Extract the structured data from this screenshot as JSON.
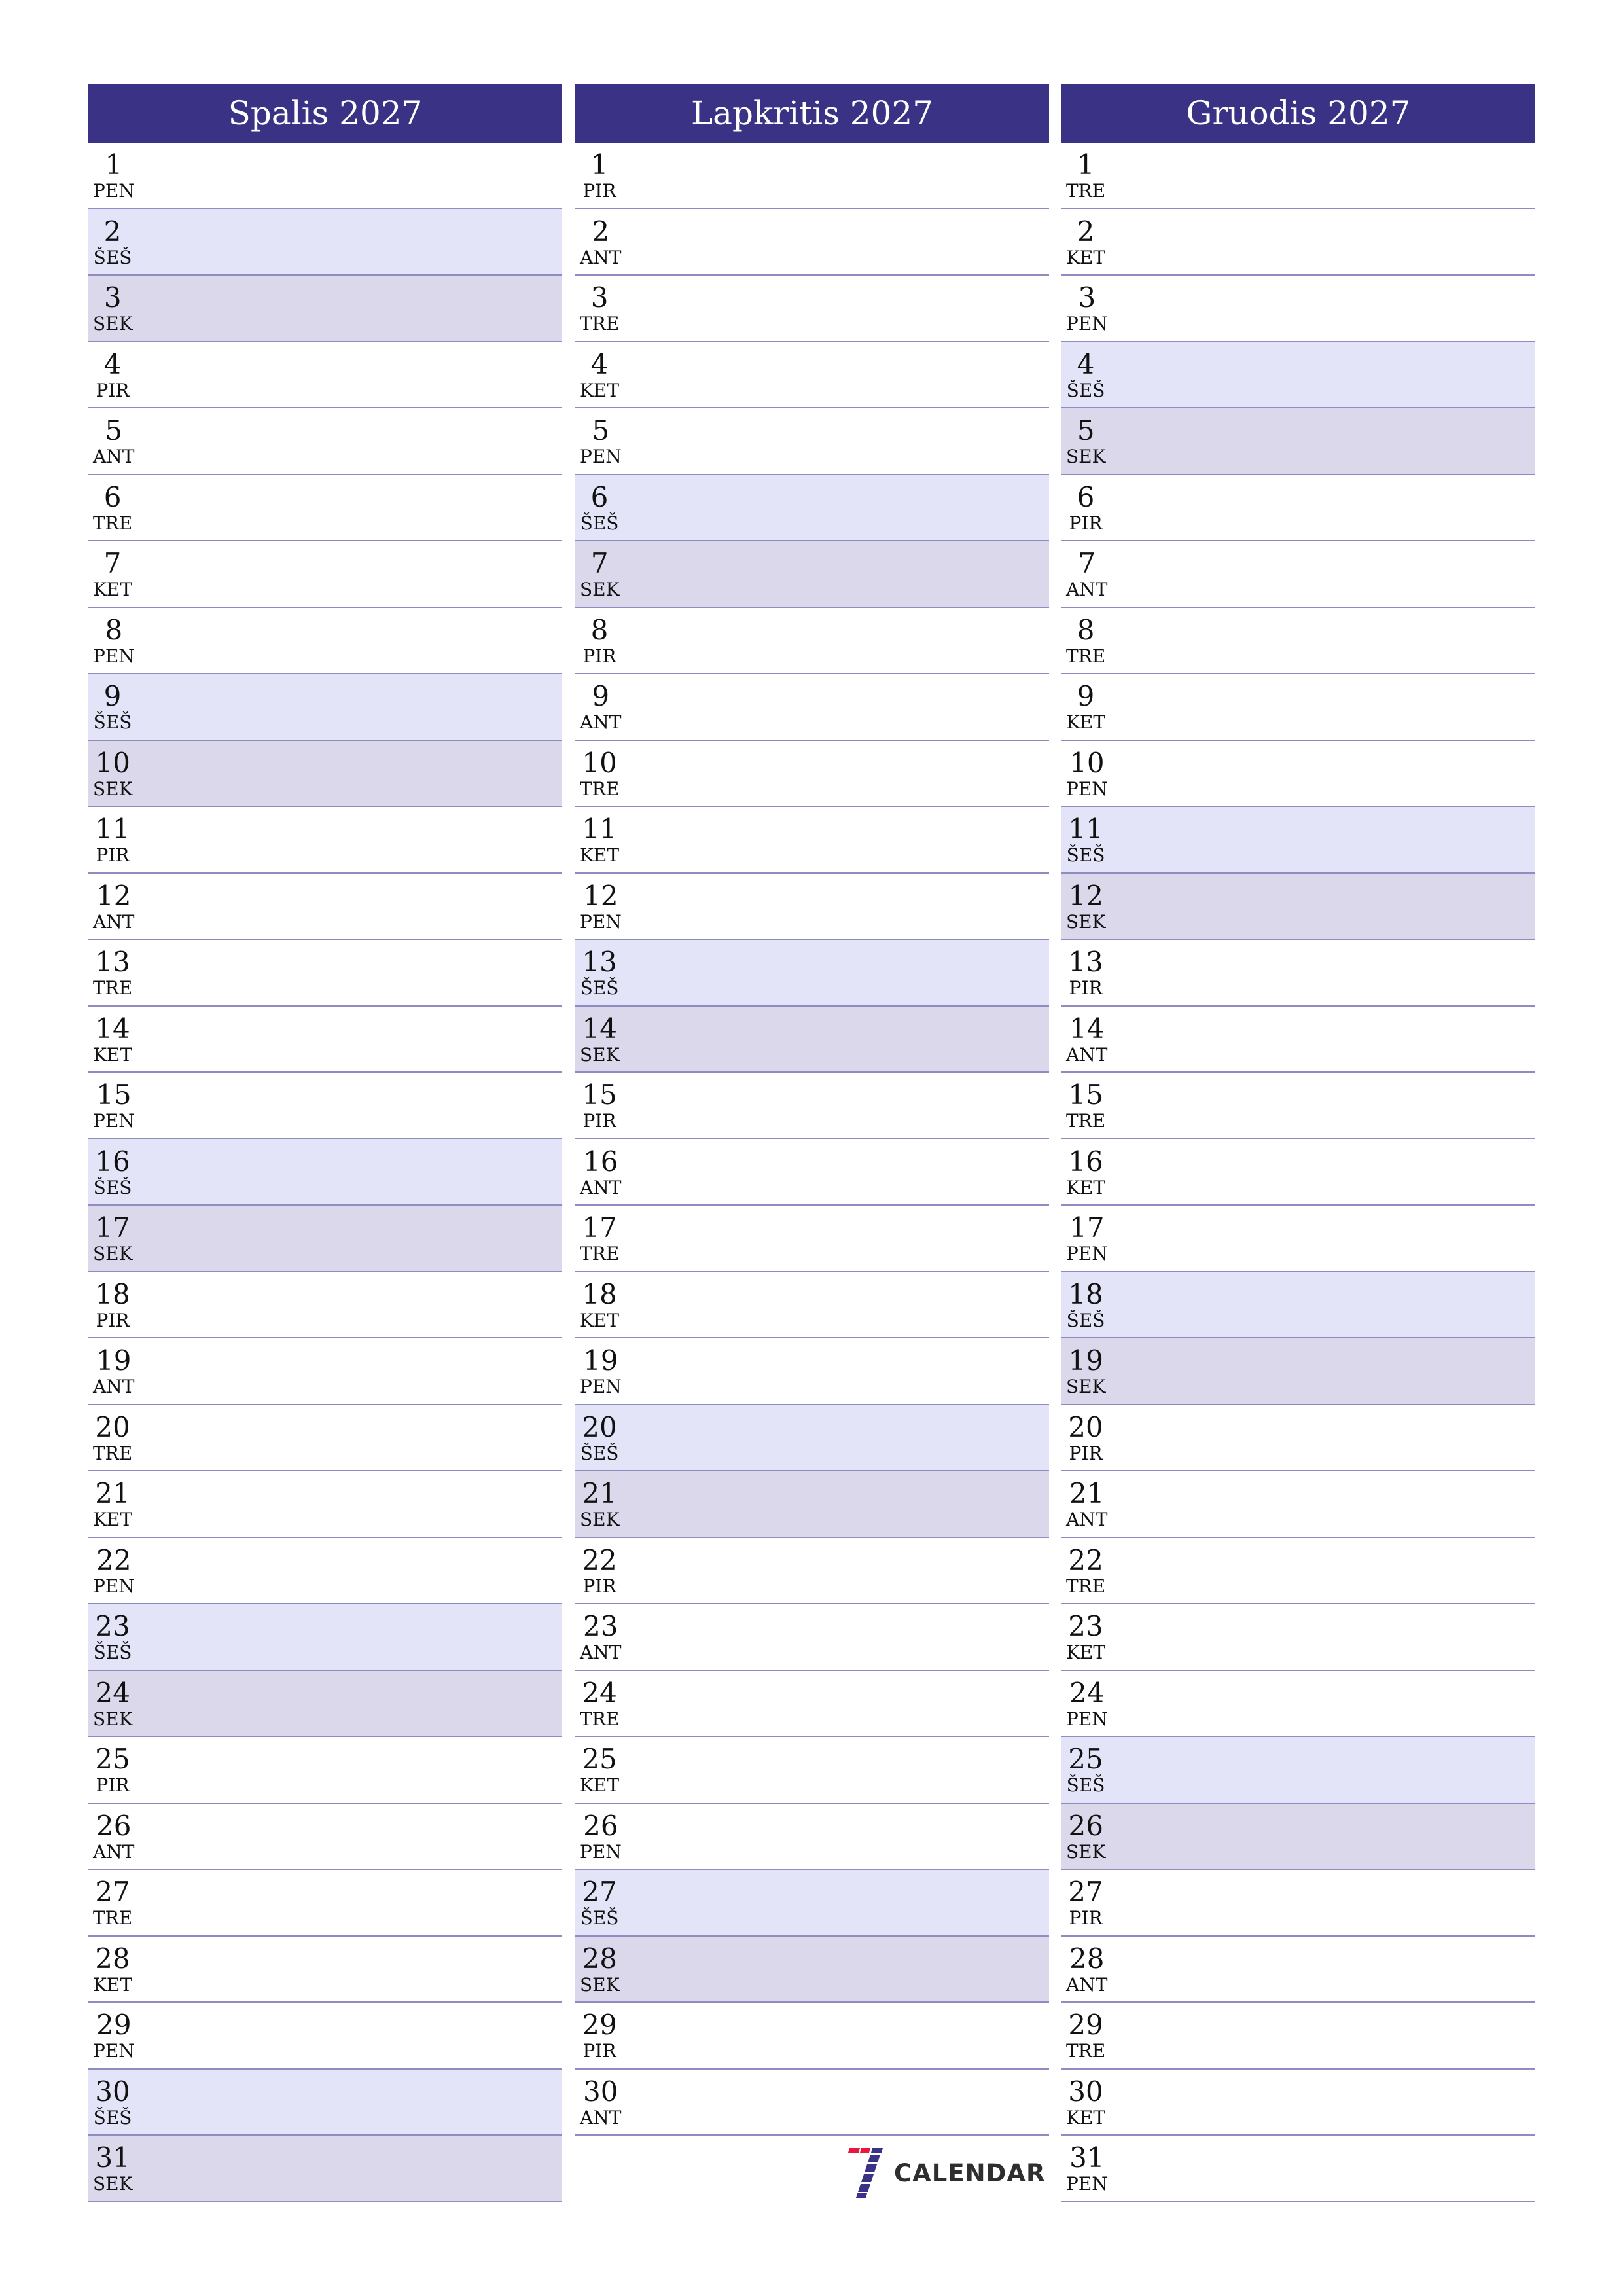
{
  "colors": {
    "header_bg": "#3a3285",
    "header_text": "#ffffff",
    "saturday_bg": "#e3e4f7",
    "sunday_bg": "#dcd8ec",
    "row_separator": "#8e8cc0",
    "logo_red": "#e8173f",
    "logo_blue": "#3a3285",
    "logo_text": "#2e2e30"
  },
  "months": [
    {
      "title": "Spalis 2027",
      "days": [
        {
          "num": "1",
          "name": "PEN",
          "type": "weekday"
        },
        {
          "num": "2",
          "name": "ŠEŠ",
          "type": "sat"
        },
        {
          "num": "3",
          "name": "SEK",
          "type": "sun"
        },
        {
          "num": "4",
          "name": "PIR",
          "type": "weekday"
        },
        {
          "num": "5",
          "name": "ANT",
          "type": "weekday"
        },
        {
          "num": "6",
          "name": "TRE",
          "type": "weekday"
        },
        {
          "num": "7",
          "name": "KET",
          "type": "weekday"
        },
        {
          "num": "8",
          "name": "PEN",
          "type": "weekday"
        },
        {
          "num": "9",
          "name": "ŠEŠ",
          "type": "sat"
        },
        {
          "num": "10",
          "name": "SEK",
          "type": "sun"
        },
        {
          "num": "11",
          "name": "PIR",
          "type": "weekday"
        },
        {
          "num": "12",
          "name": "ANT",
          "type": "weekday"
        },
        {
          "num": "13",
          "name": "TRE",
          "type": "weekday"
        },
        {
          "num": "14",
          "name": "KET",
          "type": "weekday"
        },
        {
          "num": "15",
          "name": "PEN",
          "type": "weekday"
        },
        {
          "num": "16",
          "name": "ŠEŠ",
          "type": "sat"
        },
        {
          "num": "17",
          "name": "SEK",
          "type": "sun"
        },
        {
          "num": "18",
          "name": "PIR",
          "type": "weekday"
        },
        {
          "num": "19",
          "name": "ANT",
          "type": "weekday"
        },
        {
          "num": "20",
          "name": "TRE",
          "type": "weekday"
        },
        {
          "num": "21",
          "name": "KET",
          "type": "weekday"
        },
        {
          "num": "22",
          "name": "PEN",
          "type": "weekday"
        },
        {
          "num": "23",
          "name": "ŠEŠ",
          "type": "sat"
        },
        {
          "num": "24",
          "name": "SEK",
          "type": "sun"
        },
        {
          "num": "25",
          "name": "PIR",
          "type": "weekday"
        },
        {
          "num": "26",
          "name": "ANT",
          "type": "weekday"
        },
        {
          "num": "27",
          "name": "TRE",
          "type": "weekday"
        },
        {
          "num": "28",
          "name": "KET",
          "type": "weekday"
        },
        {
          "num": "29",
          "name": "PEN",
          "type": "weekday"
        },
        {
          "num": "30",
          "name": "ŠEŠ",
          "type": "sat"
        },
        {
          "num": "31",
          "name": "SEK",
          "type": "sun"
        }
      ]
    },
    {
      "title": "Lapkritis 2027",
      "days": [
        {
          "num": "1",
          "name": "PIR",
          "type": "weekday"
        },
        {
          "num": "2",
          "name": "ANT",
          "type": "weekday"
        },
        {
          "num": "3",
          "name": "TRE",
          "type": "weekday"
        },
        {
          "num": "4",
          "name": "KET",
          "type": "weekday"
        },
        {
          "num": "5",
          "name": "PEN",
          "type": "weekday"
        },
        {
          "num": "6",
          "name": "ŠEŠ",
          "type": "sat"
        },
        {
          "num": "7",
          "name": "SEK",
          "type": "sun"
        },
        {
          "num": "8",
          "name": "PIR",
          "type": "weekday"
        },
        {
          "num": "9",
          "name": "ANT",
          "type": "weekday"
        },
        {
          "num": "10",
          "name": "TRE",
          "type": "weekday"
        },
        {
          "num": "11",
          "name": "KET",
          "type": "weekday"
        },
        {
          "num": "12",
          "name": "PEN",
          "type": "weekday"
        },
        {
          "num": "13",
          "name": "ŠEŠ",
          "type": "sat"
        },
        {
          "num": "14",
          "name": "SEK",
          "type": "sun"
        },
        {
          "num": "15",
          "name": "PIR",
          "type": "weekday"
        },
        {
          "num": "16",
          "name": "ANT",
          "type": "weekday"
        },
        {
          "num": "17",
          "name": "TRE",
          "type": "weekday"
        },
        {
          "num": "18",
          "name": "KET",
          "type": "weekday"
        },
        {
          "num": "19",
          "name": "PEN",
          "type": "weekday"
        },
        {
          "num": "20",
          "name": "ŠEŠ",
          "type": "sat"
        },
        {
          "num": "21",
          "name": "SEK",
          "type": "sun"
        },
        {
          "num": "22",
          "name": "PIR",
          "type": "weekday"
        },
        {
          "num": "23",
          "name": "ANT",
          "type": "weekday"
        },
        {
          "num": "24",
          "name": "TRE",
          "type": "weekday"
        },
        {
          "num": "25",
          "name": "KET",
          "type": "weekday"
        },
        {
          "num": "26",
          "name": "PEN",
          "type": "weekday"
        },
        {
          "num": "27",
          "name": "ŠEŠ",
          "type": "sat"
        },
        {
          "num": "28",
          "name": "SEK",
          "type": "sun"
        },
        {
          "num": "29",
          "name": "PIR",
          "type": "weekday"
        },
        {
          "num": "30",
          "name": "ANT",
          "type": "weekday"
        }
      ]
    },
    {
      "title": "Gruodis 2027",
      "days": [
        {
          "num": "1",
          "name": "TRE",
          "type": "weekday"
        },
        {
          "num": "2",
          "name": "KET",
          "type": "weekday"
        },
        {
          "num": "3",
          "name": "PEN",
          "type": "weekday"
        },
        {
          "num": "4",
          "name": "ŠEŠ",
          "type": "sat"
        },
        {
          "num": "5",
          "name": "SEK",
          "type": "sun"
        },
        {
          "num": "6",
          "name": "PIR",
          "type": "weekday"
        },
        {
          "num": "7",
          "name": "ANT",
          "type": "weekday"
        },
        {
          "num": "8",
          "name": "TRE",
          "type": "weekday"
        },
        {
          "num": "9",
          "name": "KET",
          "type": "weekday"
        },
        {
          "num": "10",
          "name": "PEN",
          "type": "weekday"
        },
        {
          "num": "11",
          "name": "ŠEŠ",
          "type": "sat"
        },
        {
          "num": "12",
          "name": "SEK",
          "type": "sun"
        },
        {
          "num": "13",
          "name": "PIR",
          "type": "weekday"
        },
        {
          "num": "14",
          "name": "ANT",
          "type": "weekday"
        },
        {
          "num": "15",
          "name": "TRE",
          "type": "weekday"
        },
        {
          "num": "16",
          "name": "KET",
          "type": "weekday"
        },
        {
          "num": "17",
          "name": "PEN",
          "type": "weekday"
        },
        {
          "num": "18",
          "name": "ŠEŠ",
          "type": "sat"
        },
        {
          "num": "19",
          "name": "SEK",
          "type": "sun"
        },
        {
          "num": "20",
          "name": "PIR",
          "type": "weekday"
        },
        {
          "num": "21",
          "name": "ANT",
          "type": "weekday"
        },
        {
          "num": "22",
          "name": "TRE",
          "type": "weekday"
        },
        {
          "num": "23",
          "name": "KET",
          "type": "weekday"
        },
        {
          "num": "24",
          "name": "PEN",
          "type": "weekday"
        },
        {
          "num": "25",
          "name": "ŠEŠ",
          "type": "sat"
        },
        {
          "num": "26",
          "name": "SEK",
          "type": "sun"
        },
        {
          "num": "27",
          "name": "PIR",
          "type": "weekday"
        },
        {
          "num": "28",
          "name": "ANT",
          "type": "weekday"
        },
        {
          "num": "29",
          "name": "TRE",
          "type": "weekday"
        },
        {
          "num": "30",
          "name": "KET",
          "type": "weekday"
        },
        {
          "num": "31",
          "name": "PEN",
          "type": "weekday"
        }
      ]
    }
  ],
  "logo": {
    "icon": "seven-calendar-logo-icon",
    "text": "CALENDAR"
  }
}
